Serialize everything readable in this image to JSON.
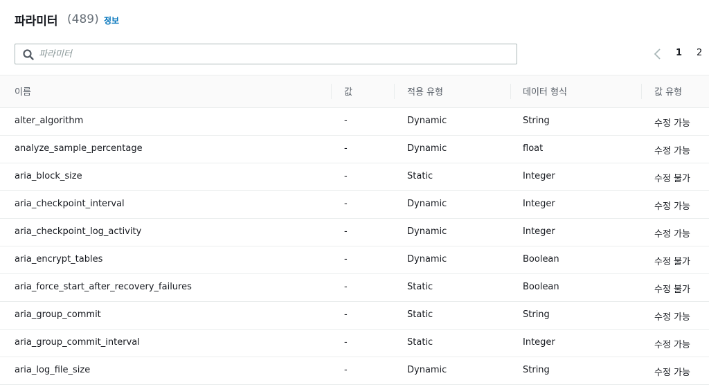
{
  "header": {
    "title": "파라미터",
    "count": "(489)",
    "info_link": "정보"
  },
  "search": {
    "placeholder": "파라미터",
    "value": ""
  },
  "pagination": {
    "pages": [
      "1",
      "2"
    ],
    "current": "1"
  },
  "table": {
    "columns": [
      "이름",
      "값",
      "적용 유형",
      "데이터 형식",
      "값 유형"
    ],
    "rows": [
      {
        "name": "alter_algorithm",
        "value": "-",
        "apply_type": "Dynamic",
        "data_type": "String",
        "modifiable": "수정 가능"
      },
      {
        "name": "analyze_sample_percentage",
        "value": "-",
        "apply_type": "Dynamic",
        "data_type": "float",
        "modifiable": "수정 가능"
      },
      {
        "name": "aria_block_size",
        "value": "-",
        "apply_type": "Static",
        "data_type": "Integer",
        "modifiable": "수정 불가"
      },
      {
        "name": "aria_checkpoint_interval",
        "value": "-",
        "apply_type": "Dynamic",
        "data_type": "Integer",
        "modifiable": "수정 가능"
      },
      {
        "name": "aria_checkpoint_log_activity",
        "value": "-",
        "apply_type": "Dynamic",
        "data_type": "Integer",
        "modifiable": "수정 가능"
      },
      {
        "name": "aria_encrypt_tables",
        "value": "-",
        "apply_type": "Dynamic",
        "data_type": "Boolean",
        "modifiable": "수정 불가"
      },
      {
        "name": "aria_force_start_after_recovery_failures",
        "value": "-",
        "apply_type": "Static",
        "data_type": "Boolean",
        "modifiable": "수정 불가"
      },
      {
        "name": "aria_group_commit",
        "value": "-",
        "apply_type": "Static",
        "data_type": "String",
        "modifiable": "수정 가능"
      },
      {
        "name": "aria_group_commit_interval",
        "value": "-",
        "apply_type": "Static",
        "data_type": "Integer",
        "modifiable": "수정 가능"
      },
      {
        "name": "aria_log_file_size",
        "value": "-",
        "apply_type": "Dynamic",
        "data_type": "String",
        "modifiable": "수정 가능"
      }
    ]
  }
}
